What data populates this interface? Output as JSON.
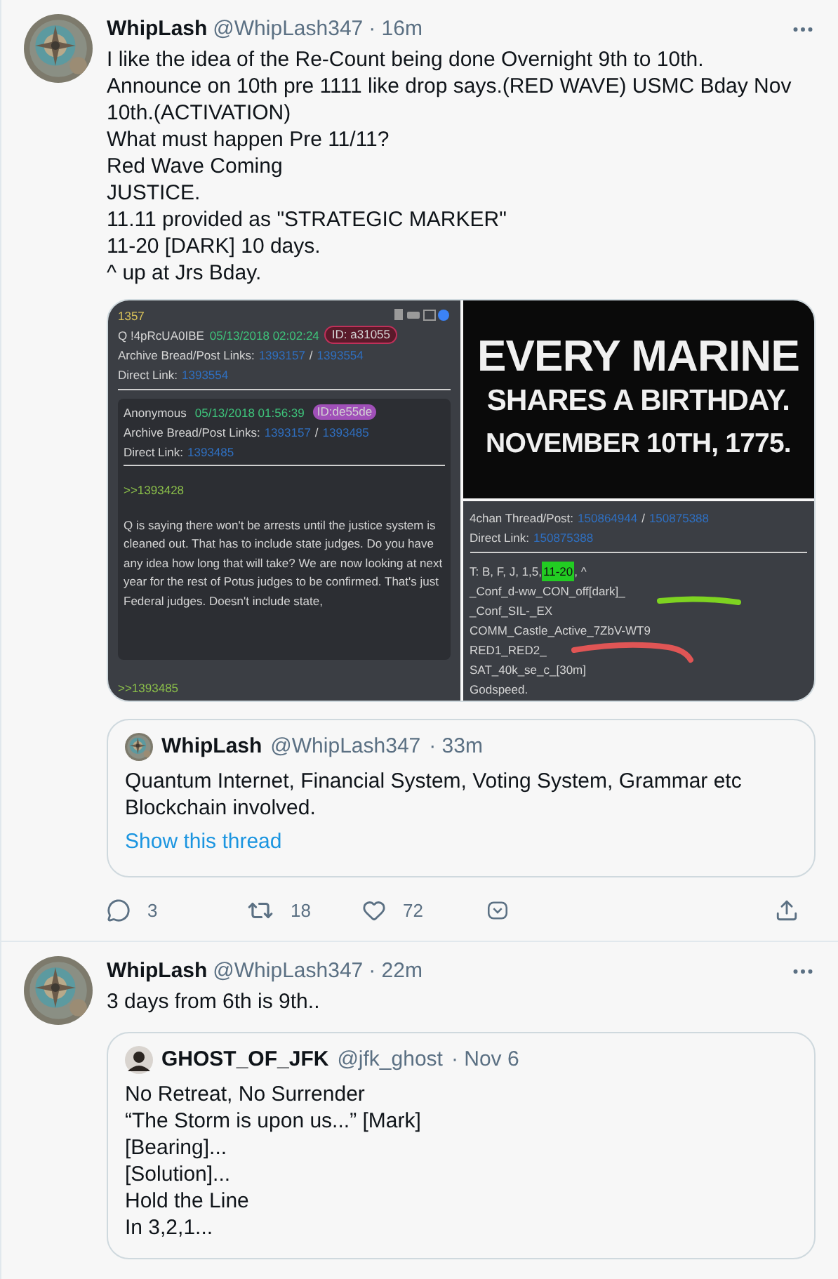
{
  "tweets": [
    {
      "name": "WhipLash",
      "handle": "@WhipLash347",
      "time": "· 16m",
      "body": [
        "I like the idea of the Re-Count being done Overnight 9th to 10th.",
        "Announce on 10th pre 1111 like drop says.(RED WAVE) USMC Bday Nov 10th.(ACTIVATION)",
        "What must happen Pre 11/11?",
        "Red Wave Coming",
        "JUSTICE.",
        "11.11 provided as \"STRATEGIC MARKER\"",
        "11-20 [DARK] 10 days.",
        "^ up at Jrs Bday."
      ],
      "media": {
        "board_post": {
          "number": "1357",
          "author": "Q !4pRcUA0IBE",
          "date": "05/13/2018 02:02:24",
          "id_badge": "ID: a31055",
          "archive_label": "Archive Bread/Post Links:",
          "archive_links": [
            "1393157",
            "1393554"
          ],
          "separator": "/",
          "direct_label": "Direct Link:",
          "direct_link": "1393554",
          "reply": {
            "author": "Anonymous",
            "date": "05/13/2018 01:56:39",
            "id_badge": "ID:de55de",
            "archive_label": "Archive Bread/Post Links:",
            "archive_links": [
              "1393157",
              "1393485"
            ],
            "separator": "/",
            "direct_label": "Direct Link:",
            "direct_link": "1393485",
            "quote_ref": ">>1393428",
            "text": "Q is saying there won't be arrests until the justice system is cleaned out. That has to include state judges. Do you have any idea how long that will take? We are now looking at next year for the rest of Potus judges to be confirmed. That's just Federal judges. Doesn't include state,"
          },
          "footer_ref": ">>1393485"
        },
        "banner": [
          "EVERY MARINE",
          "SHARES A BIRTHDAY.",
          "NOVEMBER 10TH, 1775."
        ],
        "thread_post": {
          "thread_label": "4chan Thread/Post:",
          "thread_links": [
            "150864944",
            "150875388"
          ],
          "separator": "/",
          "direct_label": "Direct Link:",
          "direct_link": "150875388",
          "first_line": {
            "before": "T: B, F, J, 1,5,",
            "highlight": "11-20",
            "after": ", ^"
          },
          "lines": [
            "_Conf_d-ww_CON_off[dark]_",
            "_Conf_SIL-_EX",
            "COMM_Castle_Active_7ZbV-WT9",
            "RED1_RED2_",
            "SAT_40k_se_c_[30m]",
            "Godspeed."
          ]
        }
      },
      "quote": {
        "kind": "picture",
        "name": "WhipLash",
        "handle": "@WhipLash347",
        "time": "· 33m",
        "body": [
          "Quantum Internet, Financial System, Voting System, Grammar etc",
          "Blockchain involved."
        ],
        "link": "Show this thread"
      },
      "actions": {
        "replies": "3",
        "retweets": "18",
        "likes": "72"
      }
    },
    {
      "name": "WhipLash",
      "handle": "@WhipLash347",
      "time": "· 22m",
      "body": [
        "3 days from 6th is 9th.."
      ],
      "quote": {
        "kind": "silhouette",
        "name": "GHOST_OF_JFK",
        "handle": "@jfk_ghost",
        "time": "· Nov 6",
        "body": [
          "No Retreat, No Surrender",
          "“The Storm is upon us...” [Mark]",
          "[Bearing]...",
          "[Solution]...",
          "Hold the Line",
          "In 3,2,1..."
        ]
      }
    }
  ]
}
